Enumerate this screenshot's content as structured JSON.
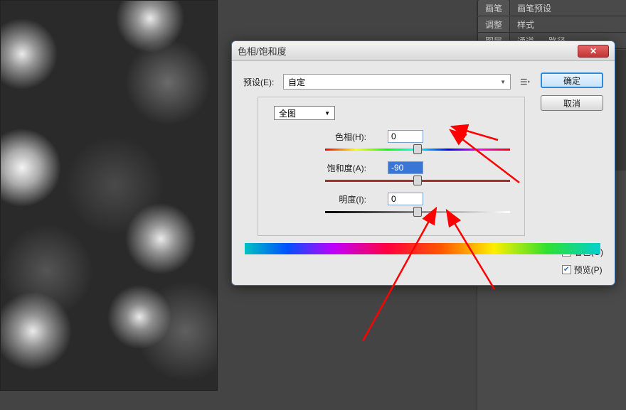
{
  "sidePanel": {
    "tabRow1": {
      "a": "画笔",
      "b": "画笔预设"
    },
    "tabRow2": {
      "a": "调整",
      "b": "样式"
    },
    "tabRow3": {
      "a": "图层",
      "b": "通道",
      "c": "路径"
    }
  },
  "dialog": {
    "title": "色相/饱和度",
    "presetLabel": "预设(E):",
    "presetValue": "自定",
    "editValue": "全图",
    "hue": {
      "label": "色相(H):",
      "value": "0"
    },
    "saturation": {
      "label": "饱和度(A):",
      "value": "-90"
    },
    "lightness": {
      "label": "明度(I):",
      "value": "0"
    },
    "okLabel": "确定",
    "cancelLabel": "取消",
    "colorizeLabel": "着色(O)",
    "previewLabel": "预览(P)",
    "previewChecked": true
  }
}
